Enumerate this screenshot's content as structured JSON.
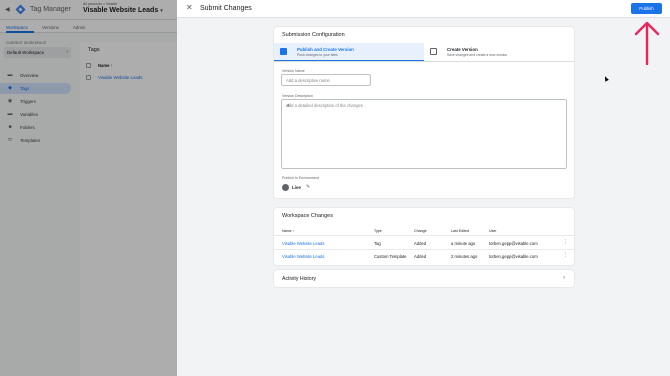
{
  "app": {
    "back_icon": "back-arrow-icon",
    "logo_icon": "gtm-logo-icon",
    "title": "Tag Manager",
    "account_crumb": "All accounts > Visable",
    "container_name": "Visable Website Leads"
  },
  "tabs": [
    {
      "label": "Workspace",
      "active": true
    },
    {
      "label": "Versions"
    },
    {
      "label": "Admin"
    }
  ],
  "sidebar": {
    "current_workspace_label": "CURRENT WORKSPACE",
    "workspace_name": "Default Workspace",
    "items": [
      {
        "label": "Overview",
        "icon": "overview-icon"
      },
      {
        "label": "Tags",
        "icon": "tag-icon",
        "active": true
      },
      {
        "label": "Triggers",
        "icon": "trigger-icon"
      },
      {
        "label": "Variables",
        "icon": "variable-icon"
      },
      {
        "label": "Folders",
        "icon": "folder-icon"
      },
      {
        "label": "Templates",
        "icon": "template-icon"
      }
    ]
  },
  "tags_card": {
    "title": "Tags",
    "col_name": "Name ↑",
    "rows": [
      "Visable Website Leads"
    ]
  },
  "panel": {
    "title": "Submit Changes",
    "close_icon": "close-icon",
    "publish_label": "Publish",
    "config": {
      "title": "Submission Configuration",
      "option_publish_title": "Publish and Create Version",
      "option_publish_sub": "Push changes to your sites",
      "option_create_title": "Create Version",
      "option_create_sub": "Save changes and create a new version",
      "version_name_label": "Version Name",
      "version_name_placeholder": "Add a descriptive name",
      "version_desc_label": "Version Description",
      "version_desc_placeholder": "Add a detailed description of the changes",
      "env_label": "Publish to Environment",
      "env_value": "Live"
    },
    "changes": {
      "title": "Workspace Changes",
      "headers": [
        "Name ↑",
        "Type",
        "Change",
        "Last Edited",
        "User"
      ],
      "rows": [
        {
          "name": "Visable Website Leads",
          "type": "Tag",
          "change": "Added",
          "edited": "a minute ago",
          "user": "torben.gepp@visable.com"
        },
        {
          "name": "Visable Website Leads",
          "type": "Custom Template",
          "change": "Added",
          "edited": "2 minutes ago",
          "user": "torben.gepp@visable.com"
        }
      ]
    },
    "activity_title": "Activity History"
  },
  "colors": {
    "accent": "#1a73e8",
    "annotation_arrow": "#e8265e"
  }
}
